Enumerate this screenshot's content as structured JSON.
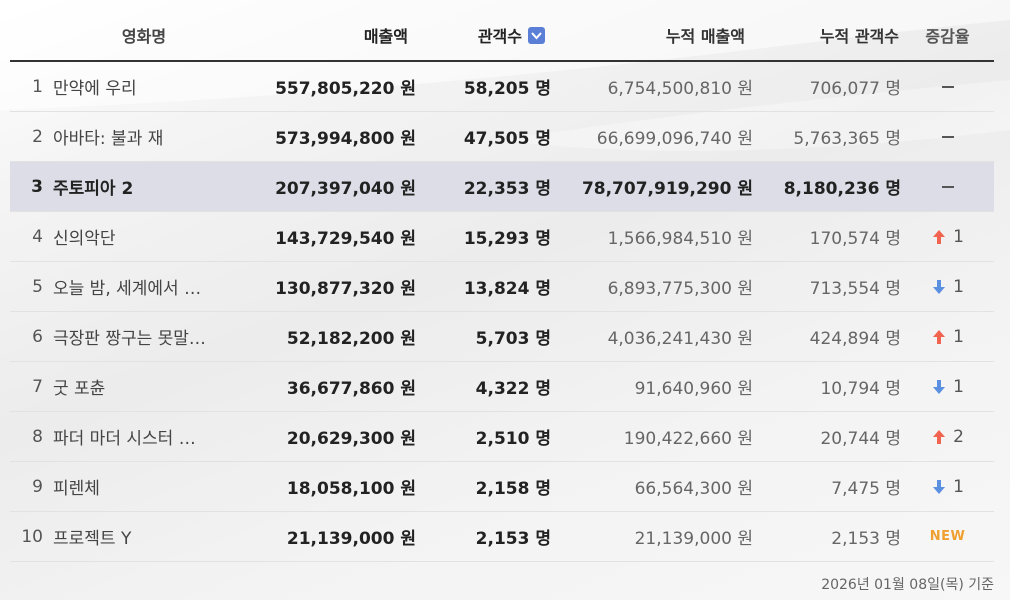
{
  "headers": {
    "title": "영화명",
    "revenue": "매출액",
    "audience": "관객수",
    "cum_revenue": "누적 매출액",
    "cum_audience": "누적 관객수",
    "change": "증감율"
  },
  "rows": [
    {
      "rank": "1",
      "title": "만약에 우리",
      "revenue": "557,805,220 원",
      "audience": "58,205 명",
      "cum_revenue": "6,754,500,810 원",
      "cum_audience": "706,077 명",
      "change_type": "same",
      "change": ""
    },
    {
      "rank": "2",
      "title": "아바타: 불과 재",
      "revenue": "573,994,800 원",
      "audience": "47,505 명",
      "cum_revenue": "66,699,096,740 원",
      "cum_audience": "5,763,365 명",
      "change_type": "same",
      "change": ""
    },
    {
      "rank": "3",
      "title": "주토피아 2",
      "revenue": "207,397,040 원",
      "audience": "22,353 명",
      "cum_revenue": "78,707,919,290 원",
      "cum_audience": "8,180,236 명",
      "change_type": "same",
      "change": ""
    },
    {
      "rank": "4",
      "title": "신의악단",
      "revenue": "143,729,540 원",
      "audience": "15,293 명",
      "cum_revenue": "1,566,984,510 원",
      "cum_audience": "170,574 명",
      "change_type": "up",
      "change": "1"
    },
    {
      "rank": "5",
      "title": "오늘 밤, 세계에서 …",
      "revenue": "130,877,320 원",
      "audience": "13,824 명",
      "cum_revenue": "6,893,775,300 원",
      "cum_audience": "713,554 명",
      "change_type": "down",
      "change": "1"
    },
    {
      "rank": "6",
      "title": "극장판 짱구는 못말…",
      "revenue": "52,182,200 원",
      "audience": "5,703 명",
      "cum_revenue": "4,036,241,430 원",
      "cum_audience": "424,894 명",
      "change_type": "up",
      "change": "1"
    },
    {
      "rank": "7",
      "title": "굿 포츈",
      "revenue": "36,677,860 원",
      "audience": "4,322 명",
      "cum_revenue": "91,640,960 원",
      "cum_audience": "10,794 명",
      "change_type": "down",
      "change": "1"
    },
    {
      "rank": "8",
      "title": "파더 마더 시스터 …",
      "revenue": "20,629,300 원",
      "audience": "2,510 명",
      "cum_revenue": "190,422,660 원",
      "cum_audience": "20,744 명",
      "change_type": "up",
      "change": "2"
    },
    {
      "rank": "9",
      "title": "피렌체",
      "revenue": "18,058,100 원",
      "audience": "2,158 명",
      "cum_revenue": "66,564,300 원",
      "cum_audience": "7,475 명",
      "change_type": "down",
      "change": "1"
    },
    {
      "rank": "10",
      "title": "프로젝트 Y",
      "revenue": "21,139,000 원",
      "audience": "2,153 명",
      "cum_revenue": "21,139,000 원",
      "cum_audience": "2,153 명",
      "change_type": "new",
      "change": "NEW"
    }
  ],
  "footer": "2026년 01월 08일(목) 기준",
  "colors": {
    "up": "#f06450",
    "down": "#5b8fe0",
    "new": "#f0a030",
    "sort_active": "#5b7fd6",
    "highlight_row": "#dcdde6"
  },
  "highlight_row_rank": "3"
}
